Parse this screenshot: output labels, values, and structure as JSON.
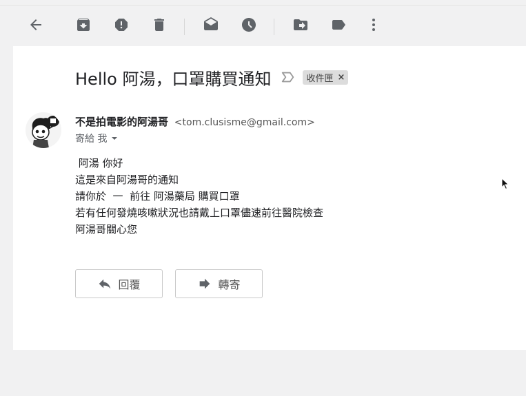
{
  "toolbar": {
    "buttons": [
      {
        "name": "back",
        "icon": "arrow-left-icon"
      },
      {
        "name": "archive",
        "icon": "archive-icon"
      },
      {
        "name": "report-spam",
        "icon": "report-spam-icon"
      },
      {
        "name": "delete",
        "icon": "trash-icon"
      },
      {
        "name": "mark-unread",
        "icon": "mark-unread-icon"
      },
      {
        "name": "snooze",
        "icon": "clock-icon"
      },
      {
        "name": "move-to",
        "icon": "move-to-icon"
      },
      {
        "name": "labels",
        "icon": "label-icon"
      },
      {
        "name": "more",
        "icon": "more-vert-icon"
      }
    ]
  },
  "email": {
    "subject": "Hello 阿湯，口罩購買通知",
    "label": "收件匣",
    "sender_name": "不是拍電影的阿湯哥",
    "sender_email": "<tom.clusisme@gmail.com>",
    "to": "寄給 我",
    "body": [
      " 阿湯 你好",
      "這是來自阿湯哥的通知",
      "請你於  一  前往 阿湯藥局 購買口罩",
      "若有任何發燒咳嗽狀況也請戴上口罩儘速前往醫院檢查",
      "阿湯哥關心您"
    ]
  },
  "actions": {
    "reply": "回覆",
    "forward": "轉寄"
  },
  "colors": {
    "icon": "#5f6368",
    "background": "#f1f1f2",
    "card": "#ffffff"
  }
}
